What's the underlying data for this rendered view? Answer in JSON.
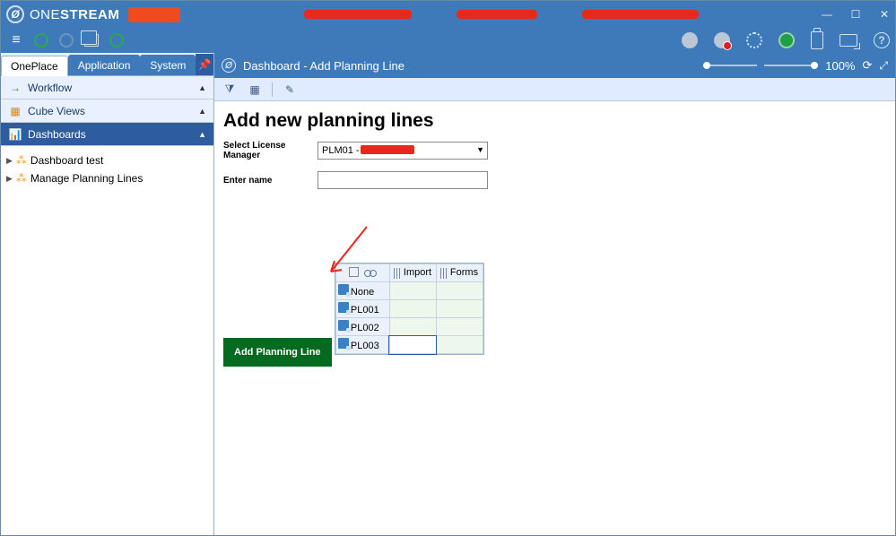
{
  "brand": {
    "one": "ONE",
    "stream": "STREAM"
  },
  "window": {
    "min": "—",
    "max": "☐",
    "close": "✕"
  },
  "zoom": "100%",
  "tabs": {
    "oneplace": "OnePlace",
    "application": "Application",
    "system": "System"
  },
  "nav": {
    "workflow": "Workflow",
    "cubeviews": "Cube Views",
    "dashboards": "Dashboards",
    "items": {
      "test": "Dashboard test",
      "manage": "Manage Planning Lines"
    }
  },
  "page": {
    "title": "Dashboard - Add Planning Line",
    "heading": "Add new planning lines",
    "select_label": "Select License Manager",
    "select_value": "PLM01 -",
    "name_label": "Enter name",
    "button": "Add Planning Line"
  },
  "grid": {
    "cols": {
      "import": "Import",
      "forms": "Forms"
    },
    "rows": {
      "none": "None",
      "pl001": "PL001",
      "pl002": "PL002",
      "pl003": "PL003"
    }
  }
}
